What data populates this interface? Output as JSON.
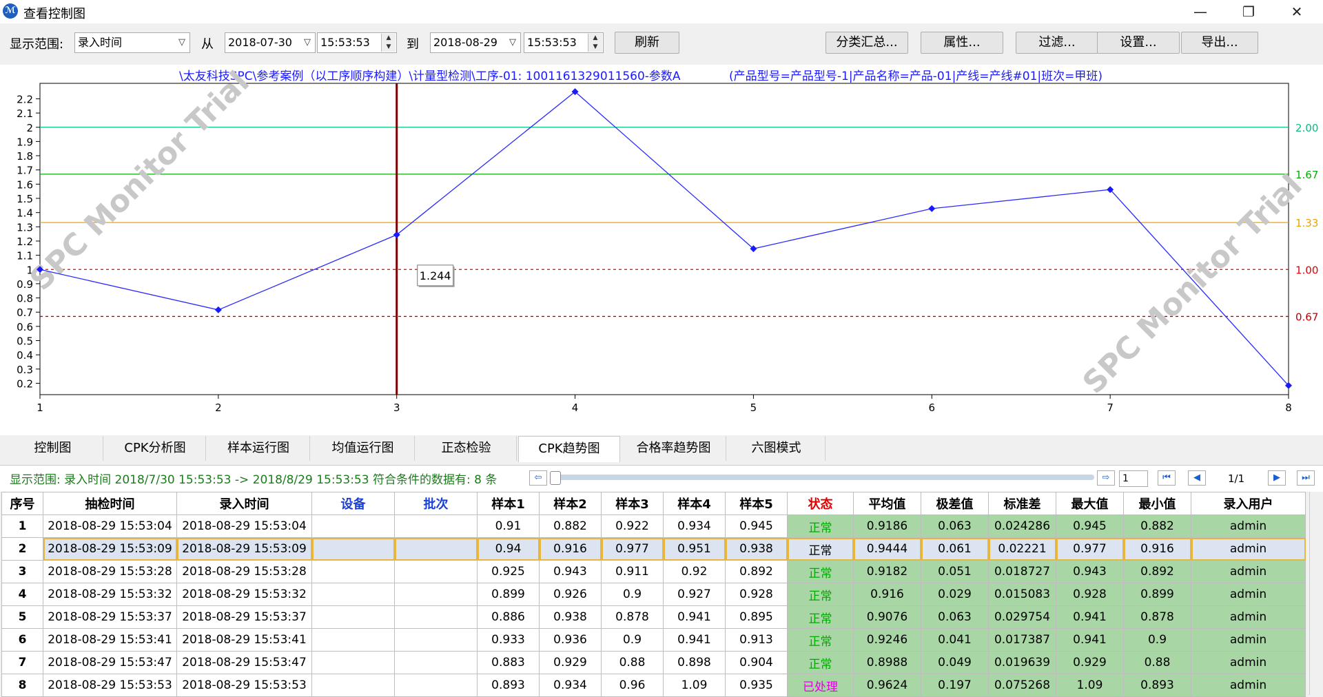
{
  "window": {
    "title": "查看控制图",
    "minimize": "—",
    "maximize": "❐",
    "close": "✕"
  },
  "toolbar": {
    "range_label": "显示范围:",
    "range_value": "录入时间",
    "from_label": "从",
    "from_date": "2018-07-30",
    "from_time": "15:53:53",
    "to_label": "到",
    "to_date": "2018-08-29",
    "to_time": "15:53:53",
    "refresh": "刷新",
    "classify": "分类汇总...",
    "properties": "属性...",
    "filter": "过滤...",
    "settings": "设置...",
    "export": "导出..."
  },
  "chart_data": {
    "type": "line",
    "title": "\\太友科技SPC\\参考案例（以工序顺序构建）\\计量型检测\\工序-01: 1001161329011560-参数A",
    "subtitle": "(产品型号=产品型号-1|产品名称=产品-01|产线=产线#01|班次=甲班)",
    "x": [
      1,
      2,
      3,
      4,
      5,
      6,
      7,
      8
    ],
    "y": [
      1.0,
      0.716,
      1.244,
      2.25,
      1.146,
      1.428,
      1.562,
      0.184
    ],
    "ylim": [
      0.12,
      2.27
    ],
    "yticks": [
      "2.2",
      "2.1",
      "2",
      "1.9",
      "1.8",
      "1.7",
      "1.6",
      "1.5",
      "1.4",
      "1.3",
      "1.2",
      "1.1",
      "1",
      "0.9",
      "0.8",
      "0.7",
      "0.6",
      "0.5",
      "0.4",
      "0.3",
      "0.2"
    ],
    "xticks": [
      "1",
      "2",
      "3",
      "4",
      "5",
      "6",
      "7",
      "8"
    ],
    "reference_lines": [
      {
        "value": 2.0,
        "label": "2.00",
        "color": "#00c080",
        "style": "solid"
      },
      {
        "value": 1.67,
        "label": "1.67",
        "color": "#00b000",
        "style": "solid"
      },
      {
        "value": 1.33,
        "label": "1.33",
        "color": "#f0a000",
        "style": "solid"
      },
      {
        "value": 1.0,
        "label": "1.00",
        "color": "#e00000",
        "style": "dashed"
      },
      {
        "value": 0.67,
        "label": "0.67",
        "color": "#c00000",
        "style": "dashed"
      }
    ],
    "cursor_x": 3,
    "tooltip": "1.244",
    "watermark": "SPC Monitor Trial",
    "series_color": "#2a2aff",
    "grid": false
  },
  "tabs": [
    "控制图",
    "CPK分析图",
    "样本运行图",
    "均值运行图",
    "正态检验",
    "CPK趋势图",
    "合格率趋势图",
    "六图模式"
  ],
  "active_tab": "CPK趋势图",
  "status": {
    "text": "显示范围: 录入时间  2018/7/30 15:53:53 -> 2018/8/29 15:53:53  符合条件的数据有: 8 条",
    "page_input": "1",
    "page_count": "1/1"
  },
  "table": {
    "headers": [
      "序号",
      "抽检时间",
      "录入时间",
      "设备",
      "批次",
      "样本1",
      "样本2",
      "样本3",
      "样本4",
      "样本5",
      "状态",
      "平均值",
      "极差值",
      "标准差",
      "最大值",
      "最小值",
      "录入用户"
    ],
    "rows": [
      [
        "1",
        "2018-08-29 15:53:04",
        "2018-08-29 15:53:04",
        "",
        "",
        "0.91",
        "0.882",
        "0.922",
        "0.934",
        "0.945",
        "正常",
        "0.9186",
        "0.063",
        "0.024286",
        "0.945",
        "0.882",
        "admin"
      ],
      [
        "2",
        "2018-08-29 15:53:09",
        "2018-08-29 15:53:09",
        "",
        "",
        "0.94",
        "0.916",
        "0.977",
        "0.951",
        "0.938",
        "正常",
        "0.9444",
        "0.061",
        "0.02221",
        "0.977",
        "0.916",
        "admin"
      ],
      [
        "3",
        "2018-08-29 15:53:28",
        "2018-08-29 15:53:28",
        "",
        "",
        "0.925",
        "0.943",
        "0.911",
        "0.92",
        "0.892",
        "正常",
        "0.9182",
        "0.051",
        "0.018727",
        "0.943",
        "0.892",
        "admin"
      ],
      [
        "4",
        "2018-08-29 15:53:32",
        "2018-08-29 15:53:32",
        "",
        "",
        "0.899",
        "0.926",
        "0.9",
        "0.927",
        "0.928",
        "正常",
        "0.916",
        "0.029",
        "0.015083",
        "0.928",
        "0.899",
        "admin"
      ],
      [
        "5",
        "2018-08-29 15:53:37",
        "2018-08-29 15:53:37",
        "",
        "",
        "0.886",
        "0.938",
        "0.878",
        "0.941",
        "0.895",
        "正常",
        "0.9076",
        "0.063",
        "0.029754",
        "0.941",
        "0.878",
        "admin"
      ],
      [
        "6",
        "2018-08-29 15:53:41",
        "2018-08-29 15:53:41",
        "",
        "",
        "0.933",
        "0.936",
        "0.9",
        "0.941",
        "0.913",
        "正常",
        "0.9246",
        "0.041",
        "0.017387",
        "0.941",
        "0.9",
        "admin"
      ],
      [
        "7",
        "2018-08-29 15:53:47",
        "2018-08-29 15:53:47",
        "",
        "",
        "0.883",
        "0.929",
        "0.88",
        "0.898",
        "0.904",
        "正常",
        "0.8988",
        "0.049",
        "0.019639",
        "0.929",
        "0.88",
        "admin"
      ],
      [
        "8",
        "2018-08-29 15:53:53",
        "2018-08-29 15:53:53",
        "",
        "",
        "0.893",
        "0.934",
        "0.96",
        "1.09",
        "0.935",
        "已处理",
        "0.9624",
        "0.197",
        "0.075268",
        "1.09",
        "0.893",
        "admin"
      ]
    ],
    "selected_row": 2
  }
}
